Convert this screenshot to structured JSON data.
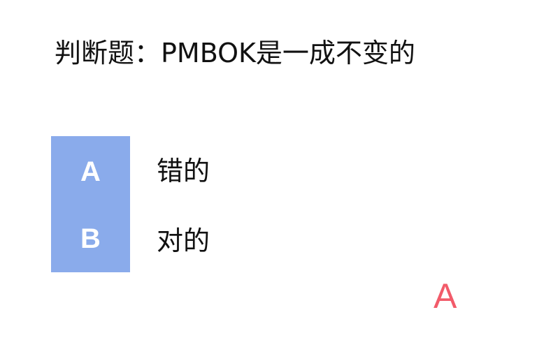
{
  "question": {
    "text": "判断题：PMBOK是一成不变的"
  },
  "options": [
    {
      "letter": "A",
      "text": "错的"
    },
    {
      "letter": "B",
      "text": "对的"
    }
  ],
  "answer": {
    "text": "A",
    "color": "#f25b6a"
  },
  "colors": {
    "letter_block": "#8aabeb",
    "letter_text": "#ffffff"
  }
}
